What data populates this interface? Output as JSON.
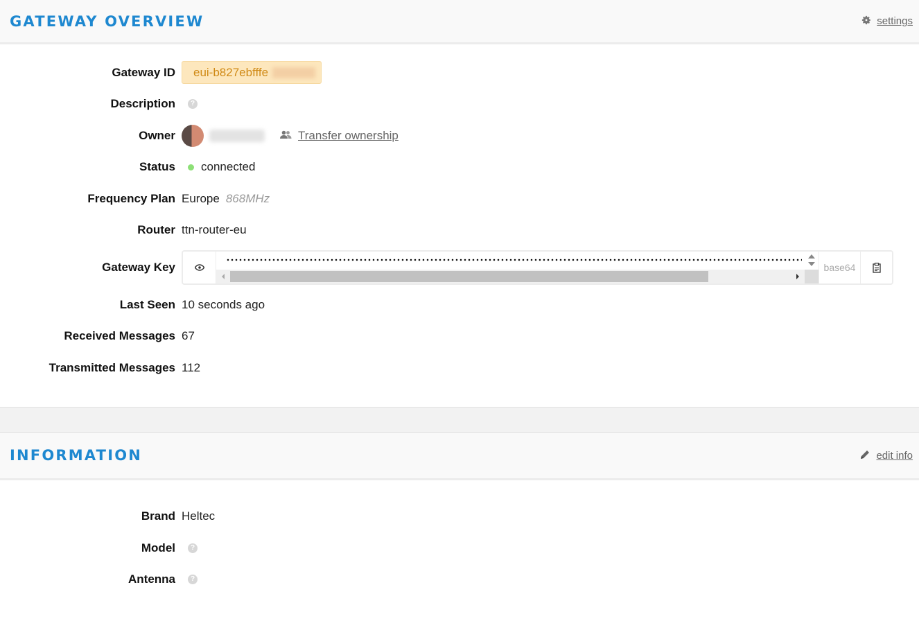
{
  "overview": {
    "title": "GATEWAY OVERVIEW",
    "settings_label": "settings",
    "fields": {
      "gateway_id_label": "Gateway ID",
      "gateway_id_value": "eui-b827ebfffe",
      "description_label": "Description",
      "owner_label": "Owner",
      "transfer_label": "Transfer ownership",
      "status_label": "Status",
      "status_value": "connected",
      "frequency_label": "Frequency Plan",
      "frequency_region": "Europe",
      "frequency_band": "868MHz",
      "router_label": "Router",
      "router_value": "ttn-router-eu",
      "gateway_key_label": "Gateway Key",
      "gateway_key_encoding": "base64",
      "last_seen_label": "Last Seen",
      "last_seen_value": "10 seconds ago",
      "received_label": "Received Messages",
      "received_value": "67",
      "transmitted_label": "Transmitted Messages",
      "transmitted_value": "112"
    }
  },
  "information": {
    "title": "INFORMATION",
    "edit_label": "edit info",
    "fields": {
      "brand_label": "Brand",
      "brand_value": "Heltec",
      "model_label": "Model",
      "antenna_label": "Antenna"
    }
  },
  "icons": {
    "settings": "gear-icon",
    "transfer": "users-icon",
    "eye": "eye-icon",
    "copy": "clipboard-icon",
    "edit": "pencil-icon",
    "help": "question-icon"
  },
  "colors": {
    "accent": "#1e88d0",
    "id_chip_bg": "#fde7bd",
    "id_chip_text": "#d08a16",
    "status_connected": "#8de077"
  }
}
